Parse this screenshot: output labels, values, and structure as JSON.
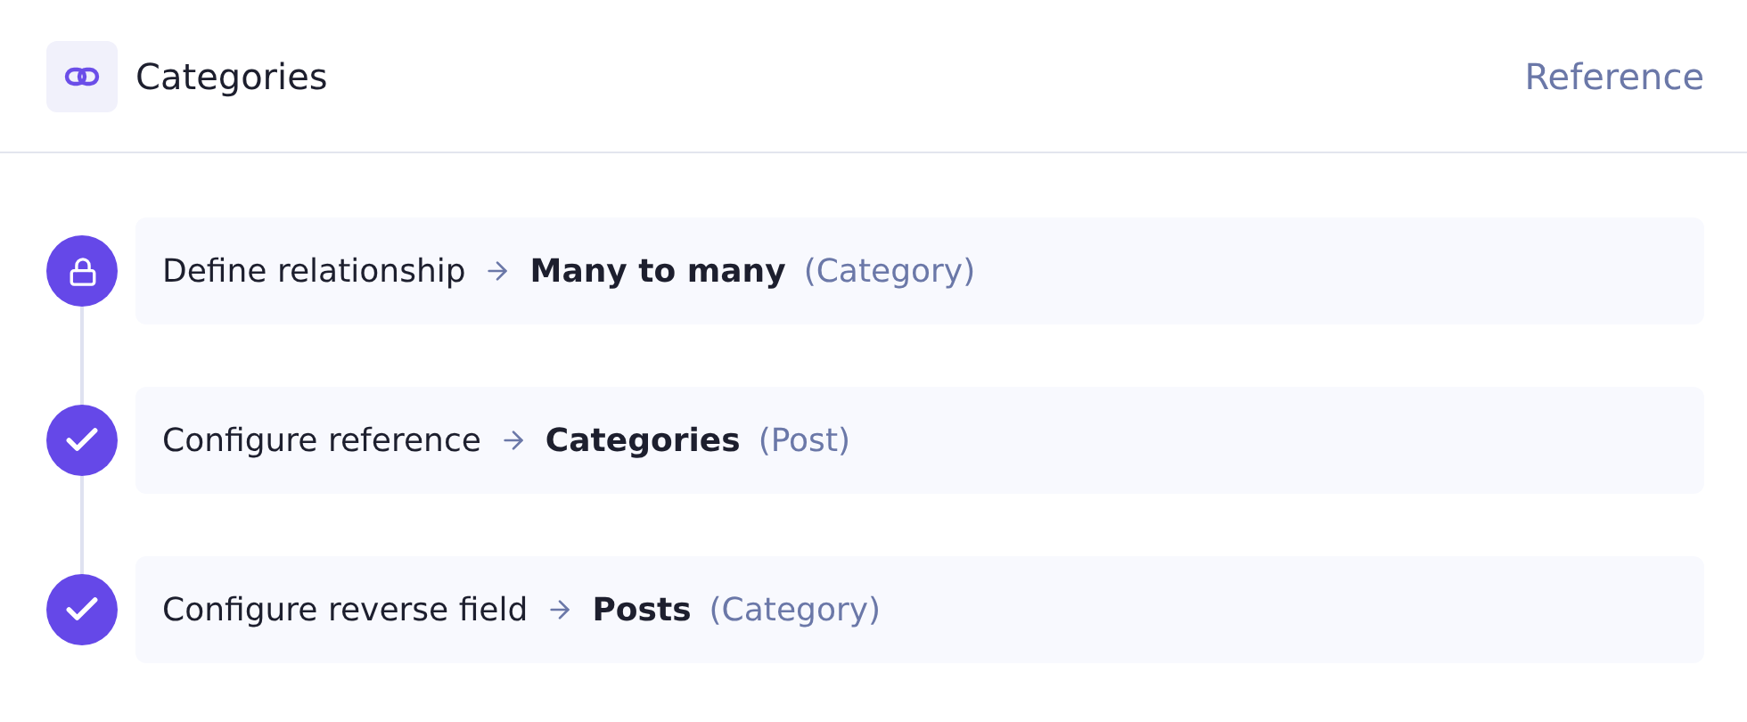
{
  "header": {
    "title": "Categories",
    "type_label": "Reference"
  },
  "steps": [
    {
      "kind": "locked",
      "label": "Define relationship",
      "value": "Many to many",
      "note": "(Category)"
    },
    {
      "kind": "done",
      "label": "Configure reference",
      "value": "Categories",
      "note": "(Post)"
    },
    {
      "kind": "done",
      "label": "Configure reverse field",
      "value": "Posts",
      "note": "(Category)"
    }
  ]
}
